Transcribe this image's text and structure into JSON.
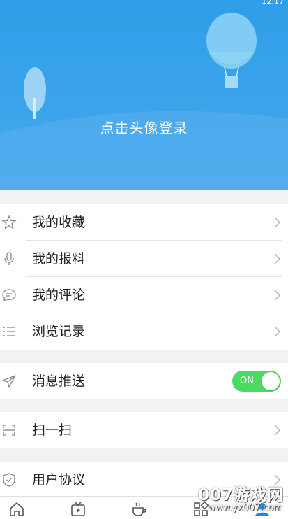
{
  "status": {
    "time": "12:17"
  },
  "header": {
    "login_prompt": "点击头像登录"
  },
  "menu_group_1": [
    {
      "label": "我的收藏",
      "icon": "star-icon"
    },
    {
      "label": "我的报料",
      "icon": "microphone-icon"
    },
    {
      "label": "我的评论",
      "icon": "comment-icon"
    },
    {
      "label": "浏览记录",
      "icon": "list-icon"
    }
  ],
  "push": {
    "label": "消息推送",
    "icon": "send-icon",
    "toggle_text": "ON",
    "enabled": true
  },
  "scan": {
    "label": "扫一扫",
    "icon": "scan-icon"
  },
  "agreement": {
    "label": "用户协议",
    "icon": "shield-icon"
  },
  "bottom_nav": [
    {
      "icon": "home-icon"
    },
    {
      "icon": "tv-icon"
    },
    {
      "icon": "coffee-icon"
    },
    {
      "icon": "apps-icon"
    },
    {
      "icon": "user-icon"
    }
  ],
  "watermark": {
    "brand": "007游戏网",
    "url": "www.yx007.com"
  },
  "colors": {
    "header_blue": "#3aa4ea",
    "toggle_green": "#4cd964",
    "nav_active": "#1e88e5"
  }
}
